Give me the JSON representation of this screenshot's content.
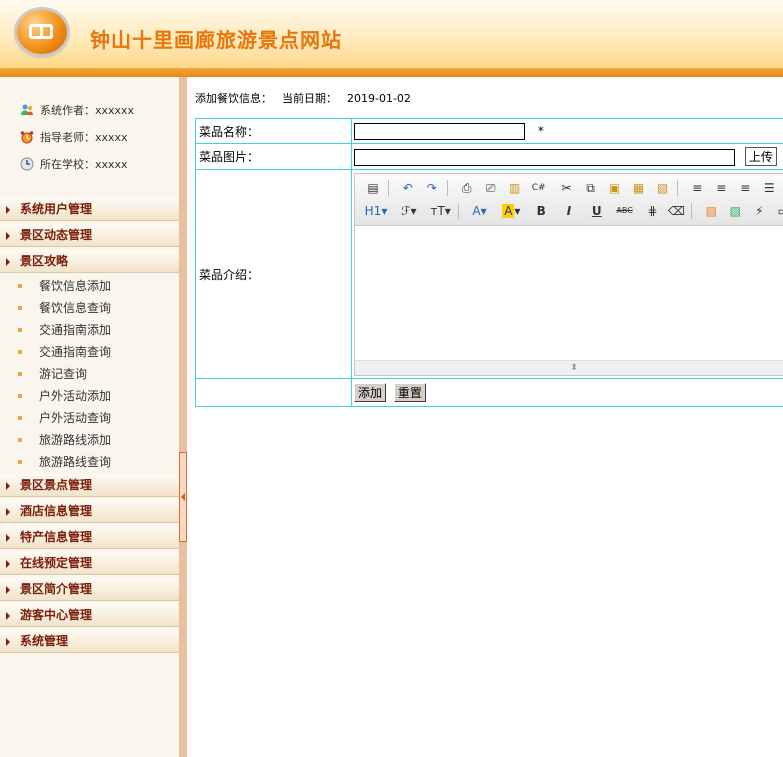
{
  "header": {
    "title": "钟山十里画廊旅游景点网站"
  },
  "sidebar": {
    "info": [
      {
        "label": "系统作者：xxxxxx",
        "icon": "users-icon"
      },
      {
        "label": "指导老师：xxxxx",
        "icon": "alarm-clock-icon"
      },
      {
        "label": "所在学校：xxxxx",
        "icon": "school-icon"
      }
    ],
    "menus": [
      {
        "label": "系统用户管理"
      },
      {
        "label": "景区动态管理"
      },
      {
        "label": "景区攻略",
        "items": [
          "餐饮信息添加",
          "餐饮信息查询",
          "交通指南添加",
          "交通指南查询",
          "游记查询",
          "户外活动添加",
          "户外活动查询",
          "旅游路线添加",
          "旅游路线查询"
        ]
      },
      {
        "label": "景区景点管理"
      },
      {
        "label": "酒店信息管理"
      },
      {
        "label": "特产信息管理"
      },
      {
        "label": "在线预定管理"
      },
      {
        "label": "景区简介管理"
      },
      {
        "label": "游客中心管理"
      },
      {
        "label": "系统管理"
      }
    ]
  },
  "main": {
    "title": "添加餐饮信息：",
    "date_label": "当前日期：",
    "date_value": "2019-01-02",
    "form": {
      "name_label": "菜品名称：",
      "name_value": "",
      "required_mark": "*",
      "image_label": "菜品图片：",
      "image_value": "",
      "upload_label": "上传",
      "intro_label": "菜品介绍：",
      "submit_label": "添加",
      "reset_label": "重置"
    },
    "toolbar": {
      "row1": [
        "source-icon",
        "undo-icon",
        "redo-icon",
        "preview-icon",
        "print-icon",
        "template-icon",
        "code-icon",
        "cut-icon",
        "copy-icon",
        "paste-icon",
        "paste-text-icon",
        "paste-word-icon",
        "align-left-icon",
        "align-center-icon",
        "align-right-icon",
        "justify-icon",
        "list-icon"
      ],
      "row2": [
        "heading-icon",
        "font-family-icon",
        "font-size-icon",
        "font-color-icon",
        "highlight-icon",
        "bold-icon",
        "italic-icon",
        "underline-icon",
        "strikethrough-icon",
        "line-height-icon",
        "eraser-icon",
        "image-icon",
        "multi-image-icon",
        "flash-icon",
        "media-icon",
        "attachment-icon"
      ],
      "row2_text": {
        "heading": "H1",
        "bold": "B",
        "italic": "I",
        "underline": "U",
        "strike": "ABC"
      }
    }
  }
}
